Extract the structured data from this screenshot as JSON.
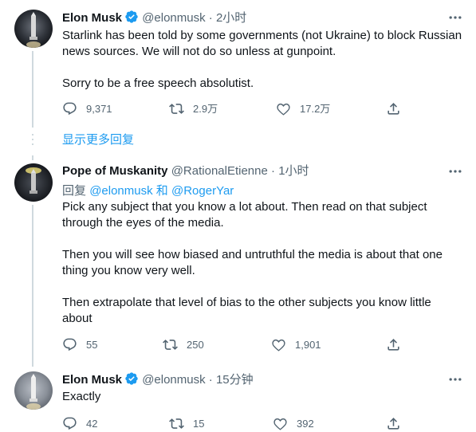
{
  "tweets": [
    {
      "name": "Elon Musk",
      "handle": "@elonmusk",
      "dot": "·",
      "time": "2小时",
      "lines": [
        "Starlink has been told by some governments (not Ukraine) to block Russian",
        "news sources. We will not do so unless at gunpoint.",
        "",
        "Sorry to be a free speech absolutist."
      ],
      "replies": "9,371",
      "retweets": "2.9万",
      "likes": "17.2万"
    },
    {
      "name": "Pope of Muskanity",
      "handle": "@RationalEtienne",
      "dot": "·",
      "time": "1小时",
      "reply_prefix": "回复",
      "reply_user1": "@elonmusk",
      "reply_and": "和",
      "reply_user2": "@RogerYar",
      "lines": [
        "Pick any subject that you know a lot about. Then read on that subject",
        "through the eyes of the media.",
        "",
        "Then you will see how biased and untruthful the media is about that one",
        "thing you know very well.",
        "",
        "Then extrapolate that level of bias to the other subjects you know little",
        "about"
      ],
      "replies": "55",
      "retweets": "250",
      "likes": "1,901"
    },
    {
      "name": "Elon Musk",
      "handle": "@elonmusk",
      "dot": "·",
      "time": "15分钟",
      "lines": [
        "Exactly"
      ],
      "replies": "42",
      "retweets": "15",
      "likes": "392"
    }
  ],
  "show_more": "显示更多回复",
  "colors": {
    "accent": "#1d9bf0",
    "muted": "#536471",
    "text": "#0f1419",
    "line": "#cfd9de"
  },
  "icons": [
    "verified-badge-icon",
    "more-icon",
    "reply-icon",
    "retweet-icon",
    "like-icon",
    "share-icon"
  ]
}
